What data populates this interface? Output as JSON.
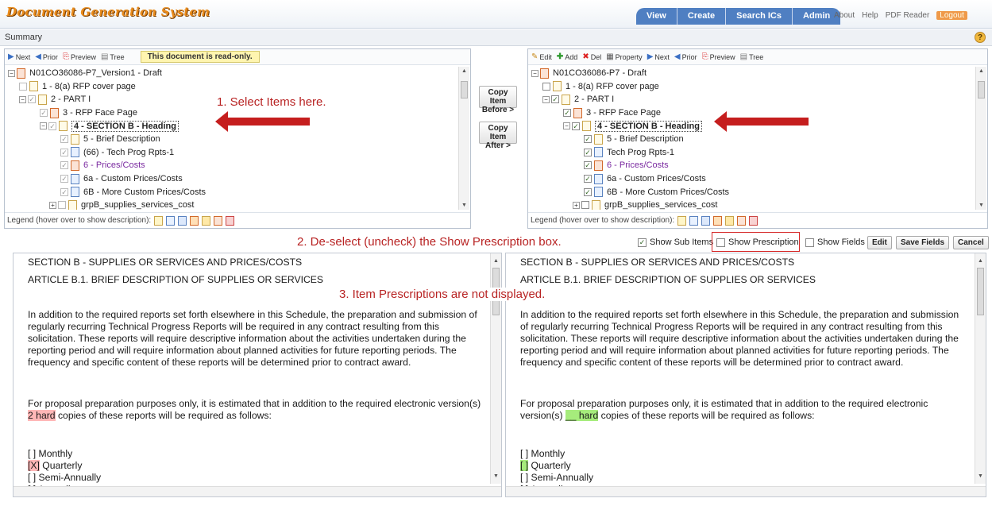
{
  "header": {
    "app_title": "Document Generation System",
    "nav_tabs": [
      "View",
      "Create",
      "Search ICs",
      "Admin"
    ],
    "links": [
      "About",
      "Help",
      "PDF Reader",
      "Logout"
    ],
    "breadcrumb": "Summary",
    "help_icon": "?"
  },
  "left_panel": {
    "toolbar": {
      "next": "Next",
      "prior": "Prior",
      "preview": "Preview",
      "tree": "Tree",
      "readonly_notice": "This document is read-only."
    },
    "tree": [
      {
        "label": "N01CO36086-P7_Version1 - Draft",
        "root": true
      },
      {
        "label": "1 - 8(a) RFP cover page"
      },
      {
        "label": "2 - PART I"
      },
      {
        "label": "3 - RFP Face Page"
      },
      {
        "label": "4 - SECTION B - Heading",
        "selected": true
      },
      {
        "label": "5 - Brief Description"
      },
      {
        "label": "(66) - Tech Prog Rpts-1"
      },
      {
        "label": "6 - Prices/Costs",
        "purple": true
      },
      {
        "label": "6a - Custom Prices/Costs"
      },
      {
        "label": "6B - More Custom Prices/Costs"
      },
      {
        "label": "grpB_supplies_services_cost"
      }
    ],
    "legend_label": "Legend (hover over to show description):"
  },
  "copy_buttons": {
    "before": "Copy Item Before >",
    "after": "Copy Item After >"
  },
  "right_panel": {
    "toolbar": {
      "edit": "Edit",
      "add": "Add",
      "del": "Del",
      "property": "Property",
      "next": "Next",
      "prior": "Prior",
      "preview": "Preview",
      "tree": "Tree"
    },
    "tree": [
      {
        "label": "N01CO36086-P7 - Draft",
        "root": true
      },
      {
        "label": "1 - 8(a) RFP cover page"
      },
      {
        "label": "2 - PART I"
      },
      {
        "label": "3 - RFP Face Page"
      },
      {
        "label": "4 - SECTION B - Heading",
        "selected": true
      },
      {
        "label": "5 - Brief Description"
      },
      {
        "label": "Tech Prog Rpts-1"
      },
      {
        "label": "6 - Prices/Costs",
        "purple": true
      },
      {
        "label": "6a - Custom Prices/Costs"
      },
      {
        "label": "6B - More Custom Prices/Costs"
      },
      {
        "label": "grpB_supplies_services_cost"
      }
    ],
    "legend_label": "Legend (hover over to show description):"
  },
  "annotations": {
    "step1": "1. Select Items here.",
    "step2": "2. De-select (uncheck) the Show Prescription box.",
    "step3": "3. Item Prescriptions are not displayed."
  },
  "options": {
    "show_sub_items": "Show Sub Items",
    "show_prescription": "Show Prescription",
    "show_fields": "Show Fields",
    "edit_btn": "Edit",
    "save_fields_btn": "Save Fields",
    "cancel_btn": "Cancel"
  },
  "left_doc": {
    "heading1": "SECTION B - SUPPLIES OR SERVICES AND PRICES/COSTS",
    "heading2": "ARTICLE B.1. BRIEF DESCRIPTION OF SUPPLIES OR SERVICES",
    "para1": "In addition to the required reports set forth elsewhere in this Schedule, the preparation and submission of regularly recurring Technical Progress Reports will be required in any contract resulting from this solicitation. These reports will require descriptive information about the activities undertaken during the reporting period and will require information about planned activities for future reporting periods. The frequency and specific content of these reports will be determined prior to contract award.",
    "para2_a": "For proposal preparation purposes only, it is estimated that in addition to the required electronic version(s) ",
    "para2_field": "2 hard",
    "para2_b": " copies of these reports will be required as follows:",
    "opt_monthly": "[ ] Monthly",
    "opt_quarterly_mark": "[X]",
    "opt_quarterly": " Quarterly",
    "opt_semi": "[ ] Semi-Annually",
    "opt_annual": "[ ] Annually"
  },
  "right_doc": {
    "heading1": "SECTION B - SUPPLIES OR SERVICES AND PRICES/COSTS",
    "heading2": "ARTICLE B.1. BRIEF DESCRIPTION OF SUPPLIES OR SERVICES",
    "para1": "In addition to the required reports set forth elsewhere in this Schedule, the preparation and submission of regularly recurring Technical Progress Reports will be required in any contract resulting from this solicitation. These reports will require descriptive information about the activities undertaken during the reporting period and will require information about planned activities for future reporting periods. The frequency and specific content of these reports will be determined prior to contract award.",
    "para2_a": "For proposal preparation purposes only, it is estimated that in addition to the required electronic version(s) ",
    "para2_field": "__ hard",
    "para2_b": " copies of these reports will be required as follows:",
    "opt_monthly": "[ ] Monthly",
    "opt_quarterly_mark": "[ ]",
    "opt_quarterly": " Quarterly",
    "opt_semi": "[ ] Semi-Annually",
    "opt_annual": "[ ] Annually"
  },
  "colors": {
    "accent_blue": "#4f7fc2",
    "annotation_red": "#c51e1e",
    "field_red": "#ffb7b7",
    "field_green": "#a6ec7c"
  }
}
